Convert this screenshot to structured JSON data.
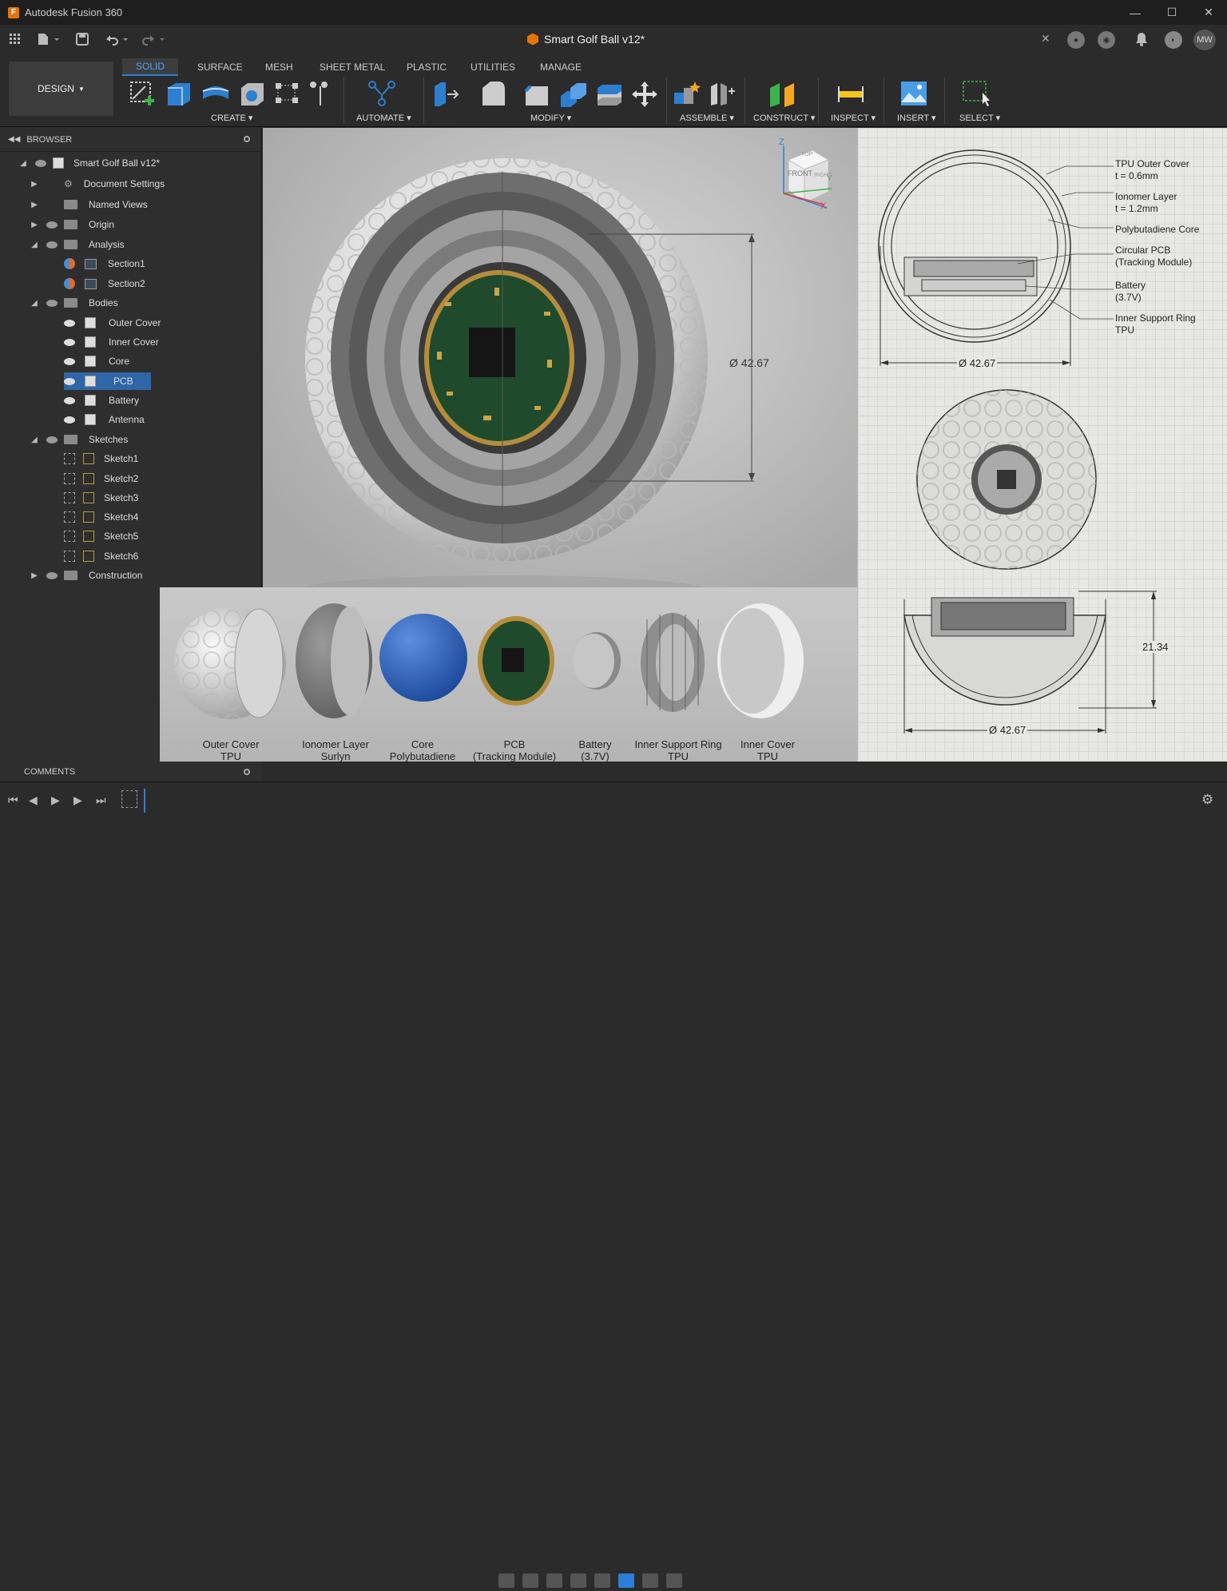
{
  "window": {
    "title": "Autodesk Fusion 360",
    "app_icon": "F"
  },
  "document": {
    "tab_title": "Smart Golf Ball v12*"
  },
  "user": {
    "initials": "MW"
  },
  "workspace": {
    "label": "DESIGN"
  },
  "ribbon": {
    "tabs": [
      "SOLID",
      "SURFACE",
      "MESH",
      "SHEET METAL",
      "PLASTIC",
      "UTILITIES",
      "MANAGE"
    ],
    "active_tab": "SOLID",
    "groups": [
      "CREATE",
      "AUTOMATE",
      "MODIFY",
      "ASSEMBLE",
      "CONSTRUCT",
      "INSPECT",
      "INSERT",
      "SELECT"
    ]
  },
  "browser": {
    "title": "BROWSER",
    "root": "Smart Golf Ball v12*",
    "items": [
      {
        "label": "Document Settings"
      },
      {
        "label": "Named Views"
      },
      {
        "label": "Origin"
      },
      {
        "label": "Analysis"
      },
      {
        "label": "Section1"
      },
      {
        "label": "Section2"
      },
      {
        "label": "Bodies"
      },
      {
        "label": "Outer Cover"
      },
      {
        "label": "Inner Cover"
      },
      {
        "label": "Core"
      },
      {
        "label": "PCB"
      },
      {
        "label": "Battery"
      },
      {
        "label": "Antenna"
      },
      {
        "label": "Sketches"
      },
      {
        "label": "Sketch1"
      },
      {
        "label": "Sketch2"
      },
      {
        "label": "Sketch3"
      },
      {
        "label": "Sketch4"
      },
      {
        "label": "Sketch5"
      },
      {
        "label": "Sketch6"
      },
      {
        "label": "Construction"
      }
    ],
    "selected": "PCB"
  },
  "comments": {
    "label": "COMMENTS"
  },
  "viewport": {
    "dimension": "Ø 42.67",
    "viewcube": {
      "front": "FRONT",
      "top": "TOP",
      "right": "RIGHT",
      "axes": [
        "Z",
        "X",
        "Y"
      ]
    }
  },
  "drawing": {
    "annotations": [
      {
        "line1": "TPU Outer Cover",
        "line2": "t = 0.6mm"
      },
      {
        "line1": "Ionomer Layer",
        "line2": "t = 1.2mm"
      },
      {
        "line1": "Polybutadiene Core",
        "line2": ""
      },
      {
        "line1": "Circular PCB",
        "line2": "(Tracking Module)"
      },
      {
        "line1": "Battery",
        "line2": "(3.7V)"
      },
      {
        "line1": "Inner Support Ring",
        "line2": "TPU"
      }
    ],
    "dim_top": "Ø 42.67",
    "dim_bottom": "Ø 42.67",
    "dim_height": "21.34"
  },
  "parts": [
    {
      "line1": "Outer Cover",
      "line2": "TPU"
    },
    {
      "line1": "Ionomer Layer",
      "line2": "Surlyn"
    },
    {
      "line1": "Core",
      "line2": "Polybutadiene"
    },
    {
      "line1": "PCB",
      "line2": "(Tracking Module)"
    },
    {
      "line1": "Battery",
      "line2": "(3.7V)"
    },
    {
      "line1": "Inner Support Ring",
      "line2": "TPU"
    },
    {
      "line1": "Inner Cover",
      "line2": "TPU"
    }
  ],
  "colors": {
    "accent": "#2b7fd8",
    "brand": "#e8730c",
    "core": "#2a62b8",
    "pcb": "#1f4a2c"
  }
}
